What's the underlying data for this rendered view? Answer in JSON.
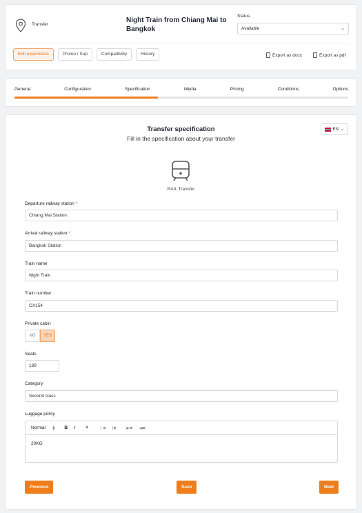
{
  "header": {
    "type_label": "Transfer",
    "title": "Night Train from Chiang Mai to Bangkok",
    "status_label": "Status",
    "status_value": "Available",
    "tabs": [
      {
        "label": "Edit experience",
        "active": true
      },
      {
        "label": "Promo / Sup",
        "active": false
      },
      {
        "label": "Compatibility",
        "active": false
      },
      {
        "label": "History",
        "active": false
      }
    ],
    "export_docx": "Export as docx",
    "export_pdf": "Export as pdf"
  },
  "steps": {
    "items": [
      "General",
      "Configuration",
      "Specification",
      "Media",
      "Pricing",
      "Conditions",
      "Options"
    ],
    "current": "Specification",
    "progress_fraction": 0.43
  },
  "form": {
    "language": "EN",
    "title": "Transfer specification",
    "subtitle": "Fill in the specification about your transfer",
    "icon_caption": "RAIL Transfer",
    "departure_label": "Departure railway station",
    "departure_value": "Chiang Mai Station",
    "arrival_label": "Arrival railway station",
    "arrival_value": "Bangkok Station",
    "train_name_label": "Train name",
    "train_name_value": "Night Train",
    "train_number_label": "Train number",
    "train_number_value": "CX154",
    "private_cabin_label": "Private cabin",
    "private_cabin_no": "NO",
    "private_cabin_yes": "YES",
    "seats_label": "Seats",
    "seats_value": "189",
    "category_label": "Category",
    "category_value": "Second class",
    "luggage_label": "Luggage policy",
    "editor_style": "Normal",
    "luggage_value": "20KG",
    "required_mark": "*"
  },
  "footer": {
    "previous": "Previous",
    "save": "Save",
    "next": "Next"
  },
  "colors": {
    "accent": "#ee7d1c",
    "required": "#e53935"
  }
}
